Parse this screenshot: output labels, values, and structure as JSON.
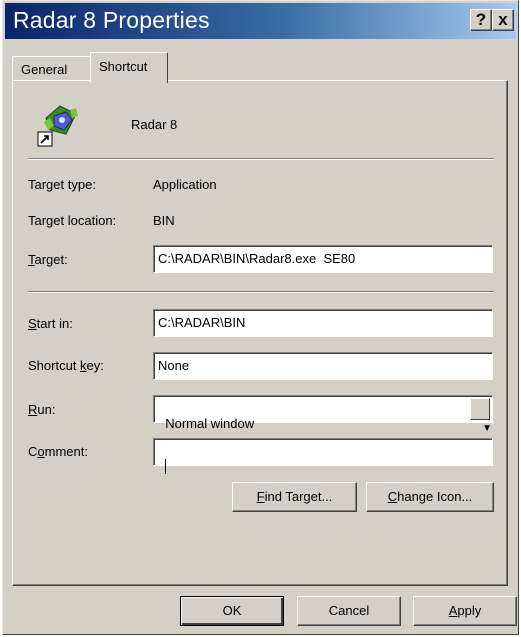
{
  "window": {
    "title": "Radar 8 Properties",
    "help_glyph": "?",
    "close_glyph": "x"
  },
  "tabs": [
    {
      "label": "General",
      "active": false
    },
    {
      "label": "Shortcut",
      "active": true
    }
  ],
  "shortcut": {
    "name": "Radar 8",
    "target_type": {
      "label": "Target type:",
      "value": "Application"
    },
    "target_location": {
      "label": "Target location:",
      "value": "BIN"
    },
    "target": {
      "label_pre": "",
      "label_key": "T",
      "label_post": "arget:",
      "value": "C:\\RADAR\\BIN\\Radar8.exe  SE80"
    },
    "start_in": {
      "label_key": "S",
      "label_post": "tart in:",
      "value": "C:\\RADAR\\BIN"
    },
    "shortcut_key": {
      "label_pre": "Shortcut ",
      "label_key": "k",
      "label_post": "ey:",
      "value": "None"
    },
    "run": {
      "label_key": "R",
      "label_post": "un:",
      "value": "Normal window"
    },
    "comment": {
      "label_pre": "C",
      "label_key": "o",
      "label_post": "mment:",
      "value": ""
    },
    "find_target": {
      "key": "F",
      "rest": "ind Target..."
    },
    "change_icon": {
      "key": "C",
      "rest": "hange Icon..."
    }
  },
  "footer": {
    "ok": "OK",
    "cancel": "Cancel",
    "apply_key": "A",
    "apply_rest": "pply"
  },
  "icons": {
    "app": "radar-app-icon",
    "shortcut_overlay": "shortcut-arrow-icon",
    "dropdown": "chevron-down-icon"
  },
  "colors": {
    "face": "#d4d0c8",
    "title_start": "#0a246a",
    "title_end": "#a6caf0"
  }
}
